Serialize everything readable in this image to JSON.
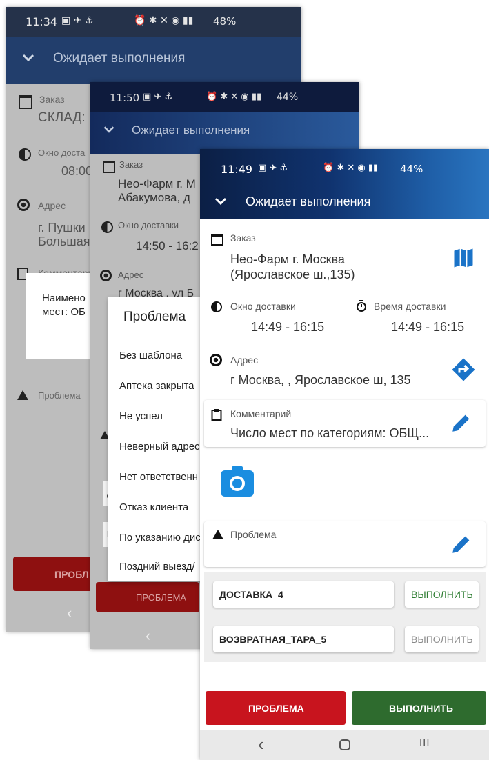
{
  "screens": {
    "back": {
      "time": "11:34",
      "battery": "48%",
      "header": "Ожидает выполнения",
      "order_label": "Заказ",
      "order_value": "СКЛАД: П",
      "window_label": "Окно доста",
      "window_value": "08:00",
      "address_label": "Адрес",
      "address_line1": "г. Пушки",
      "address_line2": "Большая",
      "comment_label": "Комментарий",
      "dialog_line1": "Наимено",
      "dialog_line2": "мест: ОБ",
      "problem_label": "Проблема",
      "problem_button": "ПРОБЛ"
    },
    "middle": {
      "time": "11:50",
      "battery": "44%",
      "header": "Ожидает выполнения",
      "order_label": "Заказ",
      "order_line1": "Нео-Фарм г. М",
      "order_line2": "Абакумова, д",
      "window_label": "Окно доставки",
      "window_value": "14:50 - 16:2",
      "address_label": "Адрес",
      "address_value": "г Москва , ул Б",
      "problem_button": "ПРОБЛЕМА",
      "row_a": "Д",
      "row_b": "В",
      "dialog_title": "Проблема",
      "options": [
        "Без шаблона",
        "Аптека закрыта",
        "Не успел",
        "Неверный адрес",
        "Нет ответственн",
        "Отказ клиента",
        "По указанию дис",
        "Поздний выезд/"
      ]
    },
    "front": {
      "time": "11:49",
      "battery": "44%",
      "header": "Ожидает выполнения",
      "order_label": "Заказ",
      "order_line1": "Нео-Фарм г. Москва",
      "order_line2": "(Ярославское ш.,135)",
      "window_label": "Окно доставки",
      "window_value": "14:49 - 16:15",
      "delivery_time_label": "Время доставки",
      "delivery_time_value": "14:49 - 16:15",
      "address_label": "Адрес",
      "address_value": "г Москва, , Ярославское ш, 135",
      "comment_label": "Комментарий",
      "comment_value": "Число мест по категориям: ОБЩ...",
      "problem_label": "Проблема",
      "tasks": [
        {
          "name": "ДОСТАВКА_4",
          "action": "ВЫПОЛНИТЬ",
          "state": "active"
        },
        {
          "name": "ВОЗВРАТНАЯ_ТАРА_5",
          "action": "ВЫПОЛНИТЬ",
          "state": "disabled"
        }
      ],
      "problem_button": "ПРОБЛЕМА",
      "complete_button": "ВЫПОЛНИТЬ"
    }
  },
  "colors": {
    "accent_blue": "#1a73c8",
    "problem_red": "#c8141e",
    "complete_green": "#2e6b2e",
    "action_green": "#2e7d32",
    "disabled_gray": "#8a8a8a"
  },
  "icons": [
    "chevron-down-icon",
    "calendar-icon",
    "clock-half-icon",
    "stopwatch-icon",
    "target-icon",
    "clipboard-icon",
    "warning-icon",
    "map-icon",
    "directions-icon",
    "pencil-icon",
    "camera-icon",
    "back-icon",
    "home-icon",
    "recents-icon"
  ]
}
